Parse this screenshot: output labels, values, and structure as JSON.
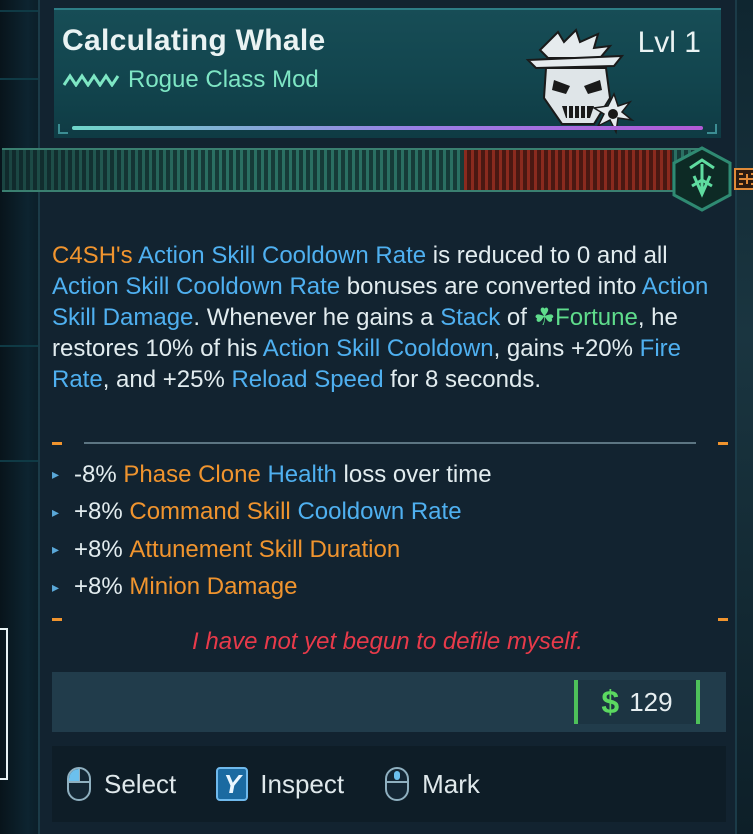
{
  "item": {
    "name": "Calculating Whale",
    "type": "Rogue Class Mod",
    "level": "Lvl 1",
    "rarity_icon": "rarity-chevrons-icon",
    "class_icon": "rogue-class-icon"
  },
  "description": {
    "segments": [
      {
        "text": "C4SH's",
        "style": "o"
      },
      {
        "text": " ",
        "style": ""
      },
      {
        "text": "Action Skill Cooldown Rate",
        "style": "b"
      },
      {
        "text": " is reduced to 0 and all ",
        "style": ""
      },
      {
        "text": "Action Skill Cooldown Rate",
        "style": "b"
      },
      {
        "text": " bonuses are converted into ",
        "style": ""
      },
      {
        "text": "Action Skill Damage",
        "style": "b"
      },
      {
        "text": ". Whenever he gains a ",
        "style": ""
      },
      {
        "text": "Stack",
        "style": "b"
      },
      {
        "text": " of ",
        "style": ""
      },
      {
        "text": "☘",
        "style": "clover"
      },
      {
        "text": "Fortune",
        "style": "g"
      },
      {
        "text": ", he restores 10% of his ",
        "style": ""
      },
      {
        "text": "Action Skill Cooldown",
        "style": "b"
      },
      {
        "text": ", gains +20% ",
        "style": ""
      },
      {
        "text": "Fire Rate",
        "style": "b"
      },
      {
        "text": ", and +25% ",
        "style": ""
      },
      {
        "text": "Reload Speed",
        "style": "b"
      },
      {
        "text": " for 8 seconds.",
        "style": ""
      }
    ]
  },
  "stats": [
    {
      "value": "-8%",
      "parts": [
        {
          "text": "Phase Clone",
          "style": "o"
        },
        {
          "text": "Health",
          "style": "b"
        },
        {
          "text": "loss over time",
          "style": ""
        }
      ]
    },
    {
      "value": "+8%",
      "parts": [
        {
          "text": "Command Skill",
          "style": "o"
        },
        {
          "text": "Cooldown Rate",
          "style": "b"
        }
      ]
    },
    {
      "value": "+8%",
      "parts": [
        {
          "text": "Attunement Skill Duration",
          "style": "o"
        }
      ]
    },
    {
      "value": "+8%",
      "parts": [
        {
          "text": "Minion Damage",
          "style": "o"
        }
      ]
    }
  ],
  "flavor_text": "I have not yet begun to defile myself.",
  "price": {
    "currency_icon": "$",
    "amount": "129"
  },
  "actions": {
    "select": "Select",
    "inspect": "Inspect",
    "inspect_key": "Y",
    "mark": "Mark"
  },
  "colors": {
    "orange": "#f0942e",
    "blue": "#4fb0f0",
    "green": "#5fdc8c",
    "red": "#e83a4a",
    "money_green": "#5bd860"
  }
}
